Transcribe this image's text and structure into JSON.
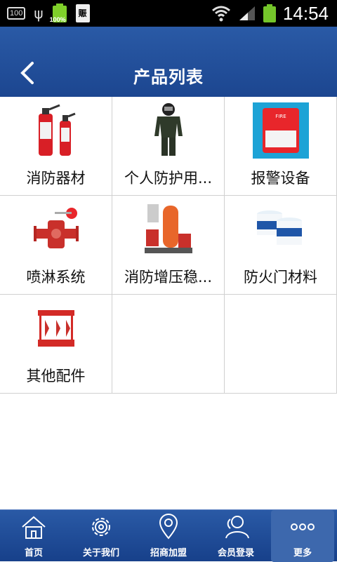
{
  "statusbar": {
    "notif_box": "100",
    "usb_glyph": "ψ",
    "battery_small_pct": "100%",
    "doc_glyph": "赈",
    "time": "14:54"
  },
  "header": {
    "title": "产品列表"
  },
  "products": [
    {
      "label": "消防器材",
      "icon": "fire-extinguisher-icon"
    },
    {
      "label": "个人防护用...",
      "icon": "protective-suit-icon"
    },
    {
      "label": "报警设备",
      "icon": "alarm-device-icon"
    },
    {
      "label": "喷淋系统",
      "icon": "sprinkler-valve-icon"
    },
    {
      "label": "消防增压稳...",
      "icon": "pressure-pump-icon"
    },
    {
      "label": "防火门材料",
      "icon": "paint-bucket-icon"
    },
    {
      "label": "其他配件",
      "icon": "fire-cabinet-icon"
    }
  ],
  "nav": [
    {
      "label": "首页",
      "icon": "home-icon"
    },
    {
      "label": "关于我们",
      "icon": "gear-icon"
    },
    {
      "label": "招商加盟",
      "icon": "location-pin-icon"
    },
    {
      "label": "会员登录",
      "icon": "user-icon"
    },
    {
      "label": "更多",
      "icon": "more-icon"
    }
  ],
  "colors": {
    "header": "#1f4c98",
    "extinguisher_red": "#d81f26",
    "grid_border": "#d0d0d0"
  }
}
